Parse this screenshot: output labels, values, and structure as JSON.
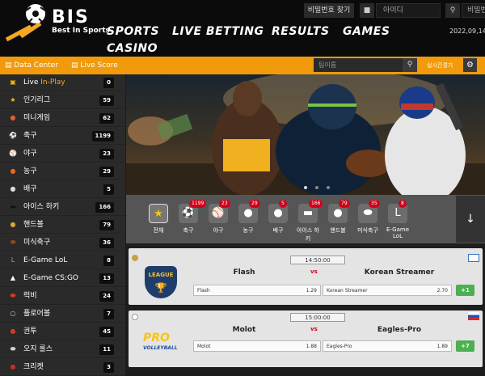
{
  "brand": {
    "name": "BIS",
    "tagline": "Best In Sports"
  },
  "nav": [
    "SPORTS",
    "LIVE BETTING",
    "RESULTS",
    "GAMES",
    "CASINO"
  ],
  "login": {
    "find_pw": "비밀번호 찾기",
    "id_placeholder": "아이디",
    "pw_placeholder": "비밀번"
  },
  "date": "2022,09,14,수",
  "bar": {
    "data_center": "Data Center",
    "live_score": "Live Score",
    "search_placeholder": "팀이름",
    "live_check": "실시간경기"
  },
  "sidebar": [
    {
      "label": "Live ",
      "label_hi": "In-Play",
      "count": "0",
      "icon": "tv-icon",
      "color": "#f2b80f"
    },
    {
      "label": "인기리그",
      "count": "59",
      "icon": "star-icon",
      "color": "#f5c518"
    },
    {
      "label": "미니게임",
      "count": "62",
      "icon": "minigame-icon",
      "color": "#e0603a"
    },
    {
      "label": "축구",
      "count": "1199",
      "icon": "soccer-ball-icon",
      "color": "#e6e6e6"
    },
    {
      "label": "야구",
      "count": "23",
      "icon": "baseball-icon",
      "color": "#f2f2f2"
    },
    {
      "label": "농구",
      "count": "29",
      "icon": "basketball-icon",
      "color": "#e86a1d"
    },
    {
      "label": "배구",
      "count": "5",
      "icon": "volleyball-icon",
      "color": "#dcdcdc"
    },
    {
      "label": "아이스 하키",
      "count": "166",
      "icon": "hockey-puck-icon",
      "color": "#111111"
    },
    {
      "label": "핸드볼",
      "count": "79",
      "icon": "handball-icon",
      "color": "#d9a441"
    },
    {
      "label": "미식축구",
      "count": "36",
      "icon": "american-football-icon",
      "color": "#8a4b1f"
    },
    {
      "label": "E-Game LoL",
      "count": "8",
      "icon": "lol-icon",
      "color": "#c8a04a"
    },
    {
      "label": "E-Game CS:GO",
      "count": "13",
      "icon": "csgo-icon",
      "color": "#ffffff"
    },
    {
      "label": "럭비",
      "count": "24",
      "icon": "rugby-icon",
      "color": "#d33a2c"
    },
    {
      "label": "플로어볼",
      "count": "7",
      "icon": "floorball-icon",
      "color": "#cfcfcf"
    },
    {
      "label": "권투",
      "count": "45",
      "icon": "boxing-glove-icon",
      "color": "#d33a2c"
    },
    {
      "label": "오지 룰스",
      "count": "11",
      "icon": "aussie-rules-icon",
      "color": "#cfcfcf"
    },
    {
      "label": "크리켓",
      "count": "3",
      "icon": "cricket-icon",
      "color": "#c72b2b"
    }
  ],
  "strip": [
    {
      "label": "전체",
      "count": "",
      "icon": "star-icon"
    },
    {
      "label": "축구",
      "count": "1199",
      "icon": "soccer-ball-icon"
    },
    {
      "label": "야구",
      "count": "23",
      "icon": "baseball-icon"
    },
    {
      "label": "농구",
      "count": "29",
      "icon": "basketball-icon"
    },
    {
      "label": "배구",
      "count": "5",
      "icon": "volleyball-icon"
    },
    {
      "label": "아이스 하키",
      "count": "166",
      "icon": "hockey-puck-icon"
    },
    {
      "label": "핸드볼",
      "count": "79",
      "icon": "handball-icon"
    },
    {
      "label": "미식축구",
      "count": "35",
      "icon": "american-football-icon"
    },
    {
      "label": "E-Game LoL",
      "count": "8",
      "icon": "lol-icon"
    }
  ],
  "matches": [
    {
      "time": "14:50:00",
      "home": "Flash",
      "away": "Korean Streamer",
      "vs": "vs",
      "home_odds": "1.29",
      "away_odds": "2.70",
      "more": "+1",
      "league_logo": "LEAGUE"
    },
    {
      "time": "15:00:00",
      "home": "Molot",
      "away": "Eagles-Pro",
      "vs": "vs",
      "home_odds": "1.88",
      "away_odds": "1.89",
      "more": "+7",
      "league_logo": "PRO"
    }
  ],
  "colors": {
    "accent": "#f19a0c",
    "badge": "#d0021b",
    "more": "#4caf50"
  }
}
